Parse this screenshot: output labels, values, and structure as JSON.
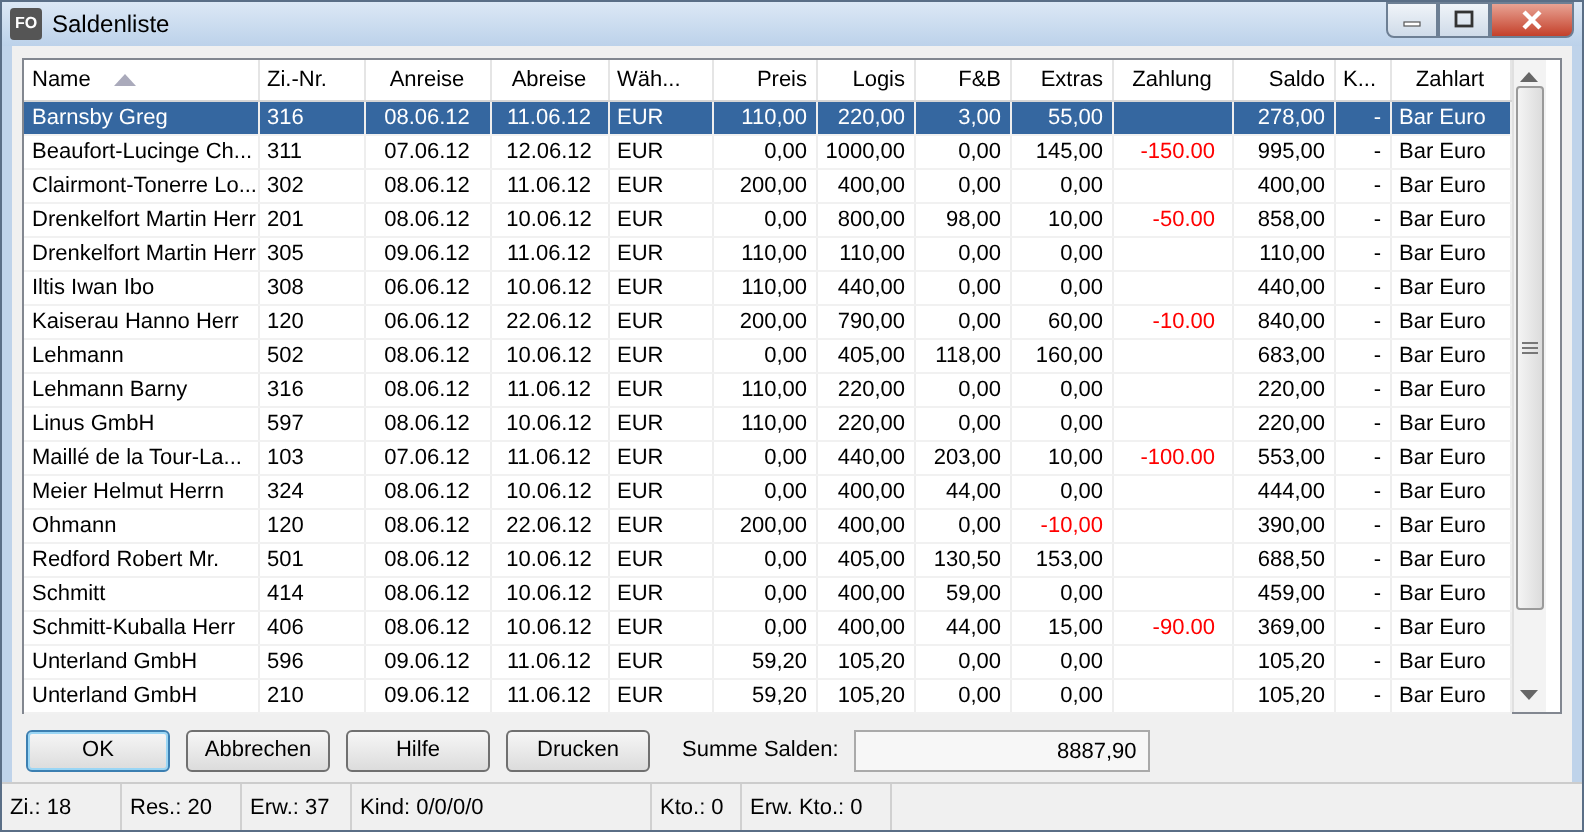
{
  "window": {
    "title": "Saldenliste",
    "logo_text": "FO"
  },
  "table": {
    "columns": [
      {
        "label": "Name",
        "sorted": true
      },
      {
        "label": "Zi.-Nr.",
        "sorted": false
      },
      {
        "label": "Anreise",
        "sorted": false
      },
      {
        "label": "Abreise",
        "sorted": false
      },
      {
        "label": "Wäh...",
        "sorted": false
      },
      {
        "label": "Preis",
        "sorted": false
      },
      {
        "label": "Logis",
        "sorted": false
      },
      {
        "label": "F&B",
        "sorted": false
      },
      {
        "label": "Extras",
        "sorted": false
      },
      {
        "label": "Zahlung",
        "sorted": false
      },
      {
        "label": "Saldo",
        "sorted": false
      },
      {
        "label": "K...",
        "sorted": false
      },
      {
        "label": "Zahlart",
        "sorted": false
      }
    ],
    "rows": [
      {
        "selected": true,
        "extras_negative": false,
        "cells": [
          "Barnsby Greg",
          "316",
          "08.06.12",
          "11.06.12",
          "EUR",
          "110,00",
          "220,00",
          "3,00",
          "55,00",
          "",
          "278,00",
          "-",
          "Bar Euro"
        ]
      },
      {
        "selected": false,
        "extras_negative": false,
        "cells": [
          "Beaufort-Lucinge Ch...",
          "311",
          "07.06.12",
          "12.06.12",
          "EUR",
          "0,00",
          "1000,00",
          "0,00",
          "145,00",
          "-150.00",
          "995,00",
          "-",
          "Bar Euro"
        ]
      },
      {
        "selected": false,
        "extras_negative": false,
        "cells": [
          "Clairmont-Tonerre Lo...",
          "302",
          "08.06.12",
          "11.06.12",
          "EUR",
          "200,00",
          "400,00",
          "0,00",
          "0,00",
          "",
          "400,00",
          "-",
          "Bar Euro"
        ]
      },
      {
        "selected": false,
        "extras_negative": false,
        "cells": [
          "Drenkelfort Martin Herr",
          "201",
          "08.06.12",
          "10.06.12",
          "EUR",
          "0,00",
          "800,00",
          "98,00",
          "10,00",
          "-50.00",
          "858,00",
          "-",
          "Bar Euro"
        ]
      },
      {
        "selected": false,
        "extras_negative": false,
        "cells": [
          "Drenkelfort Martin Herr",
          "305",
          "09.06.12",
          "11.06.12",
          "EUR",
          "110,00",
          "110,00",
          "0,00",
          "0,00",
          "",
          "110,00",
          "-",
          "Bar Euro"
        ]
      },
      {
        "selected": false,
        "extras_negative": false,
        "cells": [
          "Iltis Iwan Ibo",
          "308",
          "06.06.12",
          "10.06.12",
          "EUR",
          "110,00",
          "440,00",
          "0,00",
          "0,00",
          "",
          "440,00",
          "-",
          "Bar Euro"
        ]
      },
      {
        "selected": false,
        "extras_negative": false,
        "cells": [
          "Kaiserau Hanno Herr",
          "120",
          "06.06.12",
          "22.06.12",
          "EUR",
          "200,00",
          "790,00",
          "0,00",
          "60,00",
          "-10.00",
          "840,00",
          "-",
          "Bar Euro"
        ]
      },
      {
        "selected": false,
        "extras_negative": false,
        "cells": [
          "Lehmann",
          "502",
          "08.06.12",
          "10.06.12",
          "EUR",
          "0,00",
          "405,00",
          "118,00",
          "160,00",
          "",
          "683,00",
          "-",
          "Bar Euro"
        ]
      },
      {
        "selected": false,
        "extras_negative": false,
        "cells": [
          "Lehmann Barny",
          "316",
          "08.06.12",
          "11.06.12",
          "EUR",
          "110,00",
          "220,00",
          "0,00",
          "0,00",
          "",
          "220,00",
          "-",
          "Bar Euro"
        ]
      },
      {
        "selected": false,
        "extras_negative": false,
        "cells": [
          "Linus GmbH",
          "597",
          "08.06.12",
          "10.06.12",
          "EUR",
          "110,00",
          "220,00",
          "0,00",
          "0,00",
          "",
          "220,00",
          "-",
          "Bar Euro"
        ]
      },
      {
        "selected": false,
        "extras_negative": false,
        "cells": [
          "Maillé de la Tour-La...",
          "103",
          "07.06.12",
          "11.06.12",
          "EUR",
          "0,00",
          "440,00",
          "203,00",
          "10,00",
          "-100.00",
          "553,00",
          "-",
          "Bar Euro"
        ]
      },
      {
        "selected": false,
        "extras_negative": false,
        "cells": [
          "Meier Helmut Herrn",
          "324",
          "08.06.12",
          "10.06.12",
          "EUR",
          "0,00",
          "400,00",
          "44,00",
          "0,00",
          "",
          "444,00",
          "-",
          "Bar Euro"
        ]
      },
      {
        "selected": false,
        "extras_negative": true,
        "cells": [
          "Ohmann",
          "120",
          "08.06.12",
          "22.06.12",
          "EUR",
          "200,00",
          "400,00",
          "0,00",
          "-10,00",
          "",
          "390,00",
          "-",
          "Bar Euro"
        ]
      },
      {
        "selected": false,
        "extras_negative": false,
        "cells": [
          "Redford Robert Mr.",
          "501",
          "08.06.12",
          "10.06.12",
          "EUR",
          "0,00",
          "405,00",
          "130,50",
          "153,00",
          "",
          "688,50",
          "-",
          "Bar Euro"
        ]
      },
      {
        "selected": false,
        "extras_negative": false,
        "cells": [
          "Schmitt",
          "414",
          "08.06.12",
          "10.06.12",
          "EUR",
          "0,00",
          "400,00",
          "59,00",
          "0,00",
          "",
          "459,00",
          "-",
          "Bar Euro"
        ]
      },
      {
        "selected": false,
        "extras_negative": false,
        "cells": [
          "Schmitt-Kuballa  Herr",
          "406",
          "08.06.12",
          "10.06.12",
          "EUR",
          "0,00",
          "400,00",
          "44,00",
          "15,00",
          "-90.00",
          "369,00",
          "-",
          "Bar Euro"
        ]
      },
      {
        "selected": false,
        "extras_negative": false,
        "cells": [
          "Unterland GmbH",
          "596",
          "09.06.12",
          "11.06.12",
          "EUR",
          "59,20",
          "105,20",
          "0,00",
          "0,00",
          "",
          "105,20",
          "-",
          "Bar Euro"
        ]
      },
      {
        "selected": false,
        "extras_negative": false,
        "cells": [
          "Unterland GmbH",
          "210",
          "09.06.12",
          "11.06.12",
          "EUR",
          "59,20",
          "105,20",
          "0,00",
          "0,00",
          "",
          "105,20",
          "-",
          "Bar Euro"
        ]
      }
    ]
  },
  "buttons": [
    {
      "label": "OK",
      "focused": true
    },
    {
      "label": "Abbrechen",
      "focused": false
    },
    {
      "label": "Hilfe",
      "focused": false
    },
    {
      "label": "Drucken",
      "focused": false
    }
  ],
  "total": {
    "label": "Summe Salden:",
    "value": "8887,90"
  },
  "status_bar": [
    "Zi.: 18",
    "Res.: 20",
    "Erw.: 37",
    "Kind: 0/0/0/0",
    "Kto.: 0",
    "Erw. Kto.: 0"
  ]
}
